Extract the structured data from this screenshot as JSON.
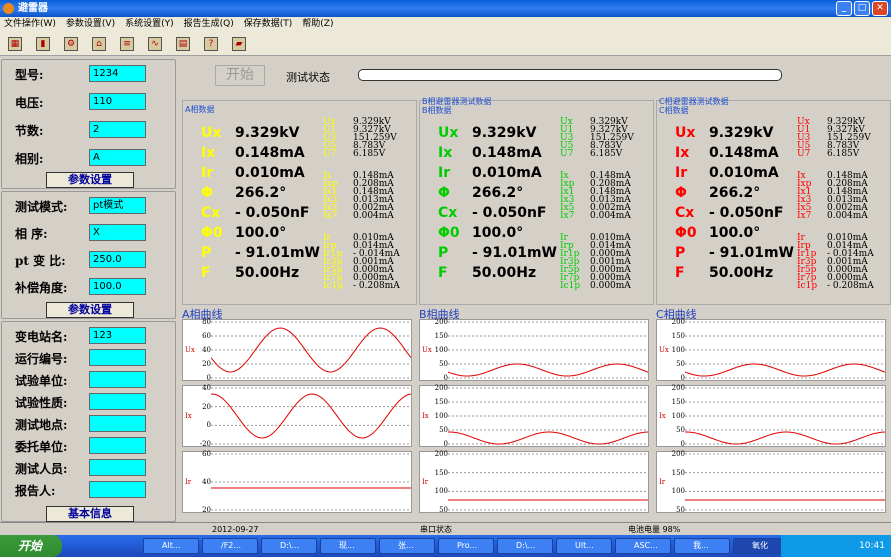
{
  "title": "避雷器",
  "menu": [
    "文件操作(W)",
    "参数设置(V)",
    "系统设置(Y)",
    "报告生成(Q)",
    "保存数据(T)",
    "帮助(Z)"
  ],
  "left": {
    "s1": [
      {
        "label": "型号:",
        "value": "1234"
      },
      {
        "label": "电压:",
        "value": "110"
      },
      {
        "label": "节数:",
        "value": "2"
      },
      {
        "label": "相别:",
        "value": "A"
      }
    ],
    "btn1": "参数设置",
    "s2": [
      {
        "label": "测试模式:",
        "value": "pt模式"
      },
      {
        "label": "相    序:",
        "value": "X"
      },
      {
        "label": "pt 变 比:",
        "value": "250.0"
      },
      {
        "label": "补偿角度:",
        "value": "100.0"
      }
    ],
    "btn2": "参数设置",
    "s3": [
      {
        "label": "变电站名:",
        "value": "123"
      },
      {
        "label": "运行编号:",
        "value": ""
      },
      {
        "label": "试验单位:",
        "value": ""
      },
      {
        "label": "试验性质:",
        "value": ""
      },
      {
        "label": "测试地点:",
        "value": ""
      },
      {
        "label": "委托单位:",
        "value": ""
      },
      {
        "label": "测试人员:",
        "value": ""
      },
      {
        "label": "报告人:",
        "value": ""
      }
    ],
    "btn3": "基本信息"
  },
  "top": {
    "start": "开始",
    "status_label": "测试状态",
    "progress": 0
  },
  "groups": [
    {
      "title": "A相数据",
      "extra": "",
      "big": [
        {
          "k": "Ux",
          "v": "9.329kV"
        },
        {
          "k": "Ix",
          "v": "0.148mA"
        },
        {
          "k": "Ir",
          "v": "0.010mA"
        },
        {
          "k": "Φ",
          "v": "266.2°"
        },
        {
          "k": "Cx",
          "v": "- 0.050nF"
        },
        {
          "k": "Φ0",
          "v": "100.0°"
        },
        {
          "k": "P",
          "v": "- 91.01mW"
        },
        {
          "k": "F",
          "v": "50.00Hz"
        }
      ],
      "lists": [
        {
          "k": [
            "Ux",
            "U1",
            "U3",
            "U5",
            "U7"
          ],
          "v": [
            "9.329kV",
            "9.327kV",
            "151.259V",
            "8.783V",
            "6.185V"
          ]
        },
        {
          "k": [
            "Ix",
            "Ixp",
            "Ix1",
            "Ix3",
            "Ix5",
            "Ix7"
          ],
          "v": [
            "0.148mA",
            "0.208mA",
            "0.148mA",
            "0.013mA",
            "0.002mA",
            "0.004mA"
          ]
        },
        {
          "k": [
            "Ir",
            "Irp",
            "Ir1p",
            "Ir3p",
            "Ir5p",
            "Ir7p",
            "Ic1p"
          ],
          "v": [
            "0.010mA",
            "0.014mA",
            "- 0.014mA",
            "0.001mA",
            "0.000mA",
            "0.000mA",
            "- 0.208mA"
          ]
        }
      ],
      "color": "#ffff00",
      "labelcolor": "#ffff00"
    },
    {
      "title": "B相数据",
      "extra": "B相避雷器测试数据",
      "big": [
        {
          "k": "Ux",
          "v": "9.329kV"
        },
        {
          "k": "Ix",
          "v": "0.148mA"
        },
        {
          "k": "Ir",
          "v": "0.010mA"
        },
        {
          "k": "Φ",
          "v": "266.2°"
        },
        {
          "k": "Cx",
          "v": "- 0.050nF"
        },
        {
          "k": "Φ0",
          "v": "100.0°"
        },
        {
          "k": "P",
          "v": "- 91.01mW"
        },
        {
          "k": "F",
          "v": "50.00Hz"
        }
      ],
      "lists": [
        {
          "k": [
            "Ux",
            "U1",
            "U3",
            "U5",
            "U7"
          ],
          "v": [
            "9.329kV",
            "9.327kV",
            "151.259V",
            "8.783V",
            "6.185V"
          ]
        },
        {
          "k": [
            "Ix",
            "Ixp",
            "Ix1",
            "Ix3",
            "Ix5",
            "Ix7"
          ],
          "v": [
            "0.148mA",
            "0.208mA",
            "0.148mA",
            "0.013mA",
            "0.002mA",
            "0.004mA"
          ]
        },
        {
          "k": [
            "Ir",
            "Irp",
            "Ir1p",
            "Ir3p",
            "Ir5p",
            "Ir7p",
            "Ic1p"
          ],
          "v": [
            "0.010mA",
            "0.014mA",
            "0.000mA",
            "0.001mA",
            "0.000mA",
            "0.000mA",
            "0.000mA"
          ]
        }
      ],
      "color": "#00cc00",
      "labelcolor": "#00cc00"
    },
    {
      "title": "C相数据",
      "extra": "C相避雷器测试数据",
      "big": [
        {
          "k": "Ux",
          "v": "9.329kV"
        },
        {
          "k": "Ix",
          "v": "0.148mA"
        },
        {
          "k": "Ir",
          "v": "0.010mA"
        },
        {
          "k": "Φ",
          "v": "266.2°"
        },
        {
          "k": "Cx",
          "v": "- 0.050nF"
        },
        {
          "k": "Φ0",
          "v": "100.0°"
        },
        {
          "k": "P",
          "v": "- 91.01mW"
        },
        {
          "k": "F",
          "v": "50.00Hz"
        }
      ],
      "lists": [
        {
          "k": [
            "Ux",
            "U1",
            "U3",
            "U5",
            "U7"
          ],
          "v": [
            "9.329kV",
            "9.327kV",
            "151.259V",
            "8.783V",
            "6.185V"
          ]
        },
        {
          "k": [
            "Ix",
            "Ixp",
            "Ix1",
            "Ix3",
            "Ix5",
            "Ix7"
          ],
          "v": [
            "0.148mA",
            "0.208mA",
            "0.148mA",
            "0.013mA",
            "0.002mA",
            "0.004mA"
          ]
        },
        {
          "k": [
            "Ir",
            "Irp",
            "Ir1p",
            "Ir3p",
            "Ir5p",
            "Ir7p",
            "Ic1p"
          ],
          "v": [
            "0.010mA",
            "0.014mA",
            "- 0.014mA",
            "0.001mA",
            "0.000mA",
            "0.000mA",
            "- 0.208mA"
          ]
        }
      ],
      "color": "#ff0000",
      "labelcolor": "#ff0000"
    }
  ],
  "curves": [
    {
      "title": "A相曲线",
      "plots": [
        {
          "label": "Ux",
          "ticks": [
            "80",
            "60",
            "40",
            "20",
            "0"
          ]
        },
        {
          "label": "Ix",
          "ticks": [
            "40",
            "20",
            "0",
            "-20"
          ]
        },
        {
          "label": "Ir",
          "ticks": [
            "60",
            "40",
            "20"
          ]
        }
      ]
    },
    {
      "title": "B相曲线",
      "plots": [
        {
          "label": "Ux",
          "ticks": [
            "200",
            "150",
            "100",
            "50",
            "0"
          ]
        },
        {
          "label": "Ix",
          "ticks": [
            "200",
            "150",
            "100",
            "50",
            "0"
          ]
        },
        {
          "label": "Ir",
          "ticks": [
            "200",
            "150",
            "100",
            "50"
          ]
        }
      ]
    },
    {
      "title": "C相曲线",
      "plots": [
        {
          "label": "Ux",
          "ticks": [
            "200",
            "150",
            "100",
            "50",
            "0"
          ]
        },
        {
          "label": "Ix",
          "ticks": [
            "200",
            "150",
            "100",
            "50",
            "0"
          ]
        },
        {
          "label": "Ir",
          "ticks": [
            "200",
            "150",
            "100",
            "50"
          ]
        }
      ]
    }
  ],
  "status": {
    "date": "2012-09-27",
    "port": "串口状态",
    "battery": "电池电量 98%"
  },
  "taskbar": {
    "start": "开始",
    "tasks": [
      "Alt...",
      "/F2...",
      "D:\\...",
      "现...",
      "张...",
      "Pro...",
      "D:\\...",
      "Ult...",
      "ASC...",
      "我...",
      "氧化"
    ],
    "time": "10:41"
  }
}
